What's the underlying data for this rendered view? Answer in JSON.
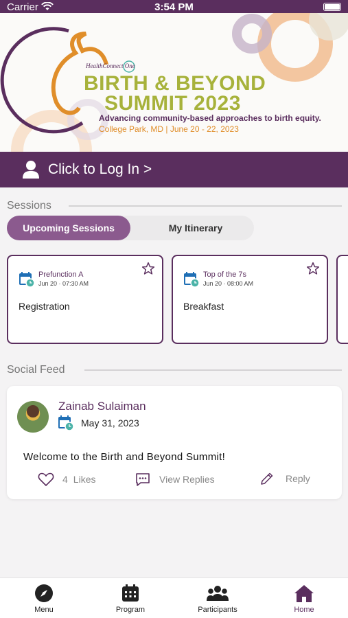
{
  "status_bar": {
    "carrier": "Carrier",
    "time": "3:54 PM"
  },
  "banner": {
    "org": "HealthConnect One",
    "title_line1": "BIRTH & BEYOND",
    "title_line2": "SUMMIT 2023",
    "tagline": "Advancing community-based approaches to birth equity.",
    "location_dates": "College Park, MD | June 20 - 22, 2023"
  },
  "login": {
    "label": "Click to Log In >"
  },
  "sessions": {
    "header": "Sessions",
    "tabs": [
      "Upcoming Sessions",
      "My Itinerary"
    ],
    "cards": [
      {
        "location": "Prefunction A",
        "when": "Jun 20 · 07:30 AM",
        "name": "Registration"
      },
      {
        "location": "Top of the 7s",
        "when": "Jun 20 · 08:00 AM",
        "name": "Breakfast"
      }
    ]
  },
  "social_feed": {
    "header": "Social Feed",
    "post": {
      "author": "Zainab Sulaiman",
      "date": "May 31, 2023",
      "text": "Welcome to the Birth and Beyond Summit!",
      "likes": "4",
      "likes_label": "Likes",
      "view_replies": "View Replies",
      "reply": "Reply"
    }
  },
  "tab_bar": {
    "items": [
      {
        "label": "Menu",
        "icon": "compass-icon"
      },
      {
        "label": "Program",
        "icon": "calendar-icon"
      },
      {
        "label": "Participants",
        "icon": "people-icon"
      },
      {
        "label": "Home",
        "icon": "home-icon"
      }
    ],
    "active": "Home"
  },
  "colors": {
    "brand_purple": "#5a2e5e",
    "accent_olive": "#a7b23b",
    "accent_orange": "#e08e2a",
    "teal": "#4bb3a8",
    "calendar_blue": "#1f6fb5"
  }
}
